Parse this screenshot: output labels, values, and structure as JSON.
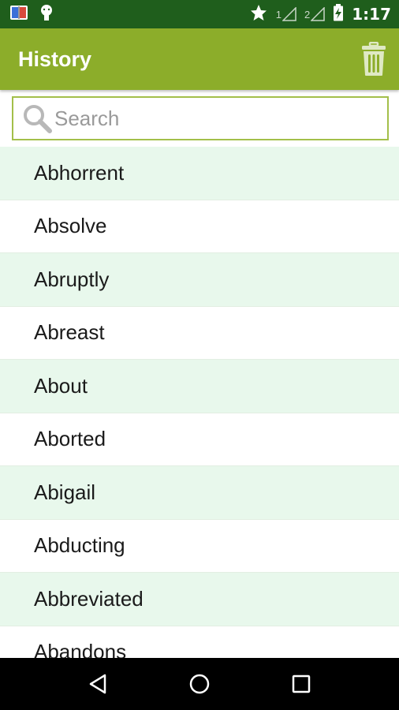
{
  "status_bar": {
    "time": "1:17",
    "sim1": "1",
    "sim2": "2",
    "icons": [
      "book-app-icon",
      "android-debug-icon",
      "star-icon",
      "signal-1-icon",
      "signal-2-icon",
      "battery-charging-icon"
    ]
  },
  "app_bar": {
    "title": "History",
    "delete_icon": "trash-icon"
  },
  "search": {
    "placeholder": "Search",
    "value": ""
  },
  "history_items": [
    "Abhorrent",
    "Absolve",
    "Abruptly",
    "Abreast",
    "About",
    "Aborted",
    "Abigail",
    "Abducting",
    "Abbreviated",
    "Abandons"
  ],
  "nav_bar": {
    "icons": [
      "back-icon",
      "home-icon",
      "recents-icon"
    ]
  },
  "colors": {
    "status_bar": "#1f5e1c",
    "app_bar": "#8cad2a",
    "row_alt": "#e8f8ec",
    "search_border": "#a3bf4a"
  }
}
